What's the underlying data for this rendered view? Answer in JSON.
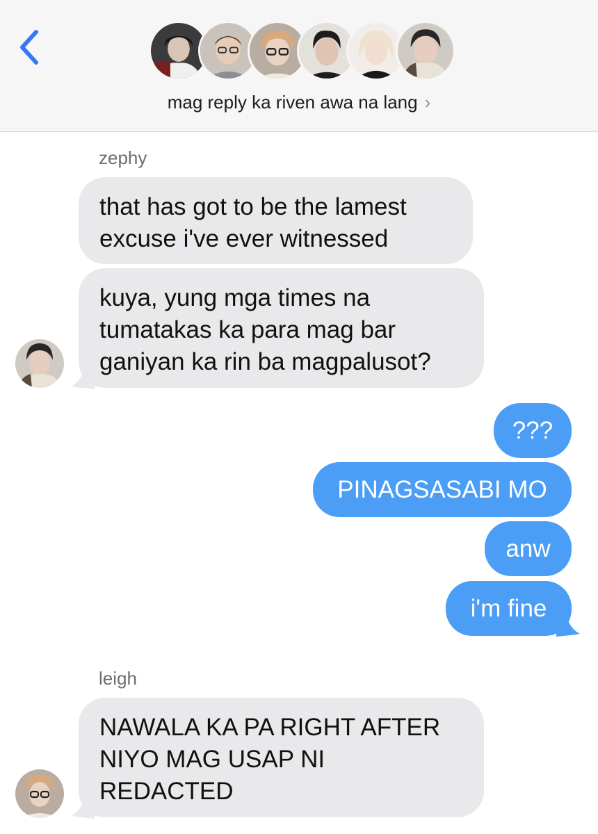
{
  "header": {
    "group_name": "mag reply ka riven awa na lang",
    "chevron": "›",
    "back_icon": "chevron-left-icon",
    "accent_color": "#3478f6",
    "participant_count_shown": 6
  },
  "messages": [
    {
      "sender": "zephy",
      "direction": "incoming",
      "text": "that has got to be the lamest excuse i've ever witnessed"
    },
    {
      "sender": "zephy",
      "direction": "incoming",
      "text": "kuya, yung mga times na tumatakas ka para mag bar ganiyan ka rin ba magpalusot?"
    },
    {
      "direction": "outgoing",
      "text": "???"
    },
    {
      "direction": "outgoing",
      "text": "PINAGSASABI MO"
    },
    {
      "direction": "outgoing",
      "text": "anw"
    },
    {
      "direction": "outgoing",
      "text": "i'm fine"
    },
    {
      "sender": "leigh",
      "direction": "incoming",
      "text": "NAWALA KA PA RIGHT AFTER NIYO MAG USAP NI REDACTED"
    }
  ],
  "colors": {
    "incoming_bubble": "#e9e9eb",
    "outgoing_bubble": "#4b9df5",
    "header_bg": "#f6f6f7"
  }
}
